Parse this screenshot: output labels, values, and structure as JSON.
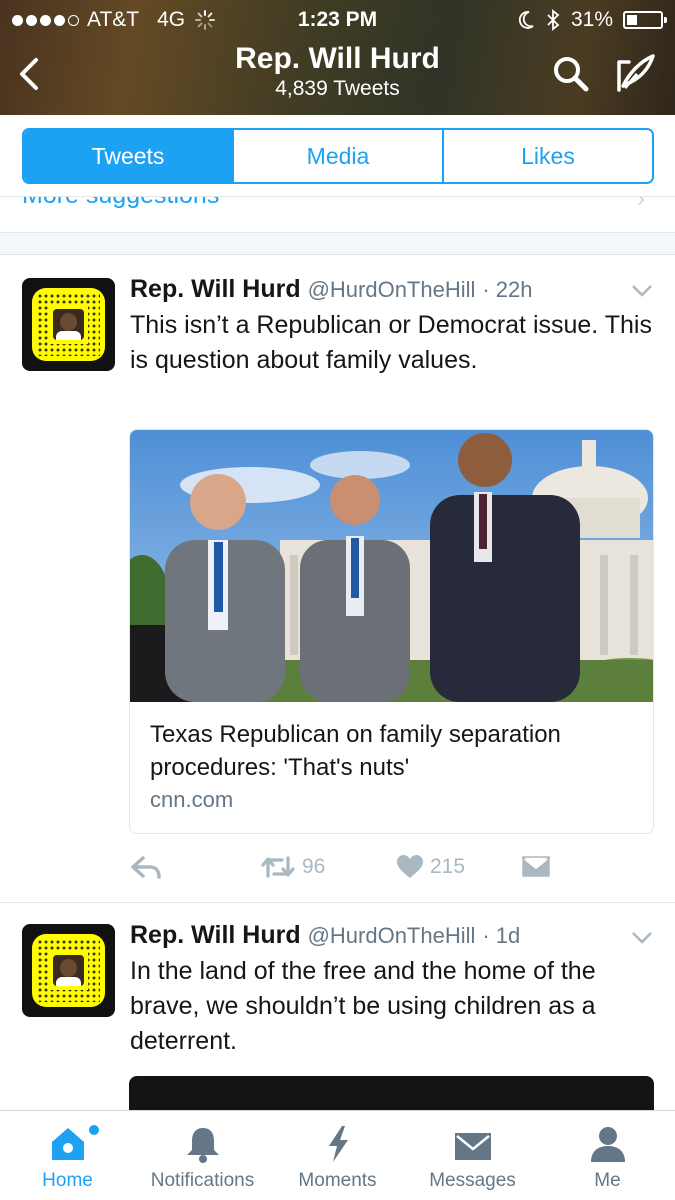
{
  "status_bar": {
    "carrier": "AT&T",
    "network": "4G",
    "time": "1:23 PM",
    "battery": "31%",
    "battery_level": 0.31
  },
  "profile_header": {
    "name": "Rep. Will Hurd",
    "tweet_count": "4,839 Tweets"
  },
  "tabs": [
    {
      "label": "Tweets",
      "active": true
    },
    {
      "label": "Media",
      "active": false
    },
    {
      "label": "Likes",
      "active": false
    }
  ],
  "more_suggestions": "More suggestions",
  "tweets": [
    {
      "name": "Rep. Will Hurd",
      "handle": "@HurdOnTheHill",
      "time": "· 22h",
      "text": "This isn’t a Republican or Democrat issue. This is question about family values.",
      "card": {
        "title": "Texas Republican on family separation procedures: 'That's nuts'",
        "domain": "cnn.com"
      },
      "retweets": "96",
      "likes": "215"
    },
    {
      "name": "Rep. Will Hurd",
      "handle": "@HurdOnTheHill",
      "time": "· 1d",
      "text": "In the land of the free and the home of the brave, we shouldn’t be using children as a deterrent."
    }
  ],
  "bottom_tabs": [
    {
      "label": "Home",
      "icon": "home-icon",
      "active": true
    },
    {
      "label": "Notifications",
      "icon": "bell-icon",
      "active": false
    },
    {
      "label": "Moments",
      "icon": "lightning-icon",
      "active": false
    },
    {
      "label": "Messages",
      "icon": "envelope-icon",
      "active": false
    },
    {
      "label": "Me",
      "icon": "person-icon",
      "active": false
    }
  ],
  "colors": {
    "accent": "#1da1f2",
    "text": "#14171a",
    "muted": "#657786",
    "icon_gray": "#aab8c2"
  }
}
